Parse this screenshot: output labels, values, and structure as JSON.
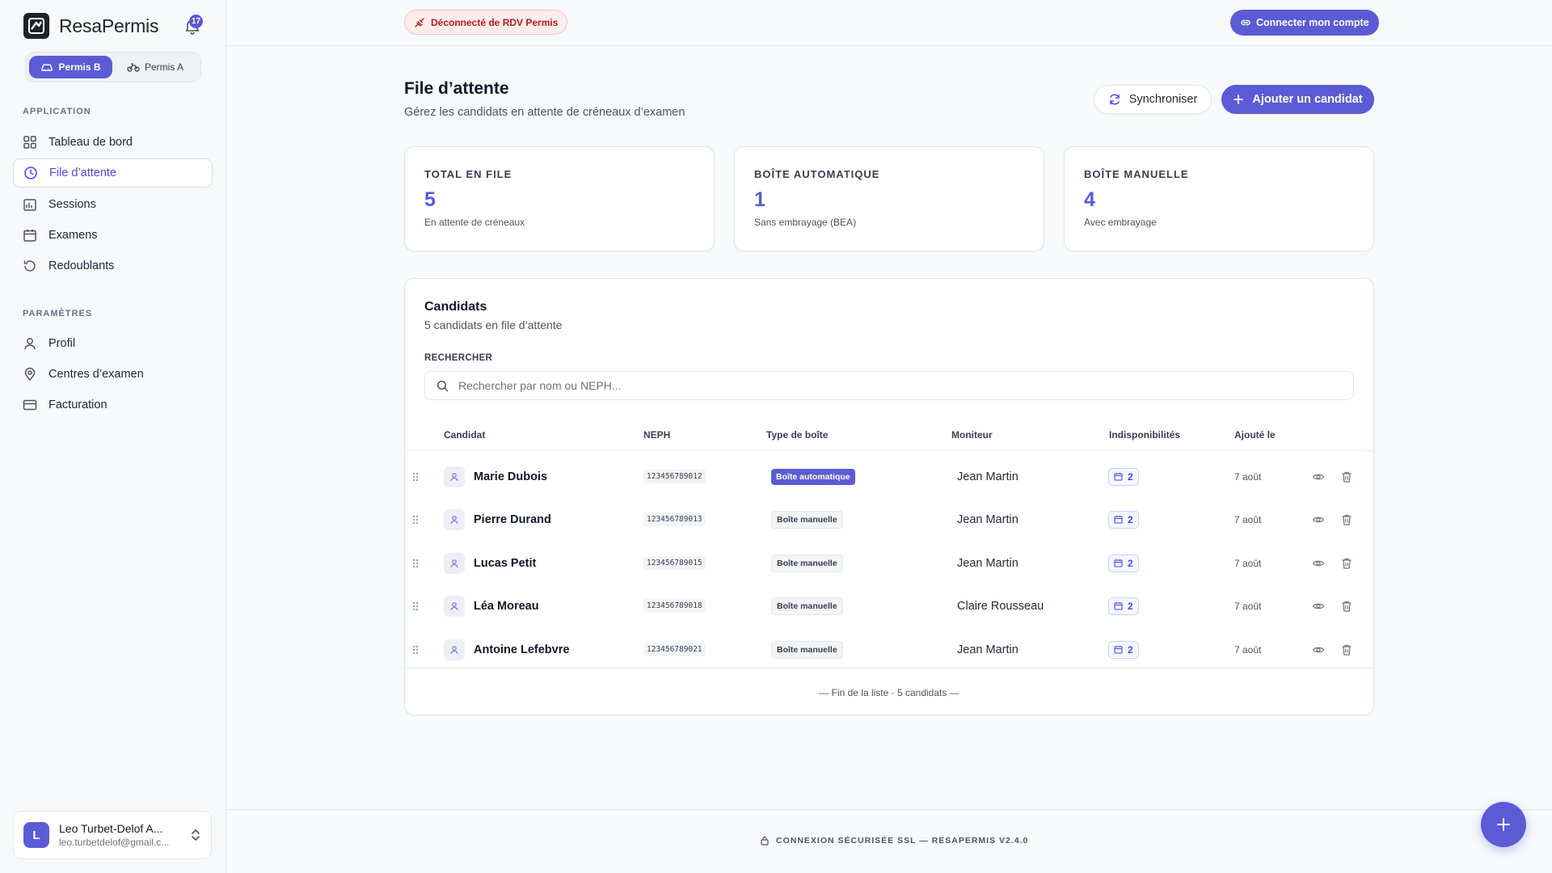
{
  "brand": {
    "name": "ResaPermis",
    "notification_count": "17"
  },
  "permit_switch": {
    "options": [
      {
        "label": "Permis B"
      },
      {
        "label": "Permis A"
      }
    ]
  },
  "sidebar": {
    "application_section": "APPLICATION",
    "application_items": [
      {
        "label": "Tableau de bord"
      },
      {
        "label": "File d’attente"
      },
      {
        "label": "Sessions"
      },
      {
        "label": "Examens"
      },
      {
        "label": "Redoublants"
      }
    ],
    "settings_section": "PARAMÈTRES",
    "settings_items": [
      {
        "label": "Profil"
      },
      {
        "label": "Centres d’examen"
      },
      {
        "label": "Facturation"
      }
    ],
    "user": {
      "initial": "L",
      "name": "Leo Turbet-Delof A...",
      "email": "leo.turbetdelof@gmail.c..."
    }
  },
  "topbar": {
    "status_label": "Déconnecté de RDV Permis",
    "connect_label": "Connecter mon compte"
  },
  "page": {
    "title": "File d’attente",
    "subtitle": "Gérez les candidats en attente de créneaux d’examen",
    "sync_label": "Synchroniser",
    "add_label": "Ajouter un candidat"
  },
  "stats": [
    {
      "label": "TOTAL EN FILE",
      "value": "5",
      "desc": "En attente de créneaux"
    },
    {
      "label": "BOÎTE AUTOMATIQUE",
      "value": "1",
      "desc": "Sans embrayage (BEA)"
    },
    {
      "label": "BOÎTE MANUELLE",
      "value": "4",
      "desc": "Avec embrayage"
    }
  ],
  "candidates": {
    "title": "Candidats",
    "subtitle": "5 candidats en file d’attente",
    "search_label": "RECHERCHER",
    "search_placeholder": "Rechercher par nom ou NEPH...",
    "columns": [
      "Candidat",
      "NEPH",
      "Type de boîte",
      "Moniteur",
      "Indisponibilités",
      "Ajouté le"
    ],
    "rows": [
      {
        "name": "Marie Dubois",
        "neph": "123456789012",
        "type": "Boîte automatique",
        "monitor": "Jean Martin",
        "unavailabilities": "2",
        "added": "7 août"
      },
      {
        "name": "Pierre Durand",
        "neph": "123456789013",
        "type": "Boîte manuelle",
        "monitor": "Jean Martin",
        "unavailabilities": "2",
        "added": "7 août"
      },
      {
        "name": "Lucas Petit",
        "neph": "123456789015",
        "type": "Boîte manuelle",
        "monitor": "Jean Martin",
        "unavailabilities": "2",
        "added": "7 août"
      },
      {
        "name": "Léa Moreau",
        "neph": "123456789018",
        "type": "Boîte manuelle",
        "monitor": "Claire Rousseau",
        "unavailabilities": "2",
        "added": "7 août"
      },
      {
        "name": "Antoine Lefebvre",
        "neph": "123456789021",
        "type": "Boîte manuelle",
        "monitor": "Jean Martin",
        "unavailabilities": "2",
        "added": "7 août"
      }
    ],
    "end_note": "— Fin de la liste · 5 candidats —"
  },
  "footer": {
    "note": "CONNEXION SÉCURISÉE SSL — RESAPERMIS V2.4.0"
  },
  "colors": {
    "accent": "#5b5bd6",
    "danger": "#b91c1c",
    "text": "#111827",
    "muted": "#4b5563"
  }
}
